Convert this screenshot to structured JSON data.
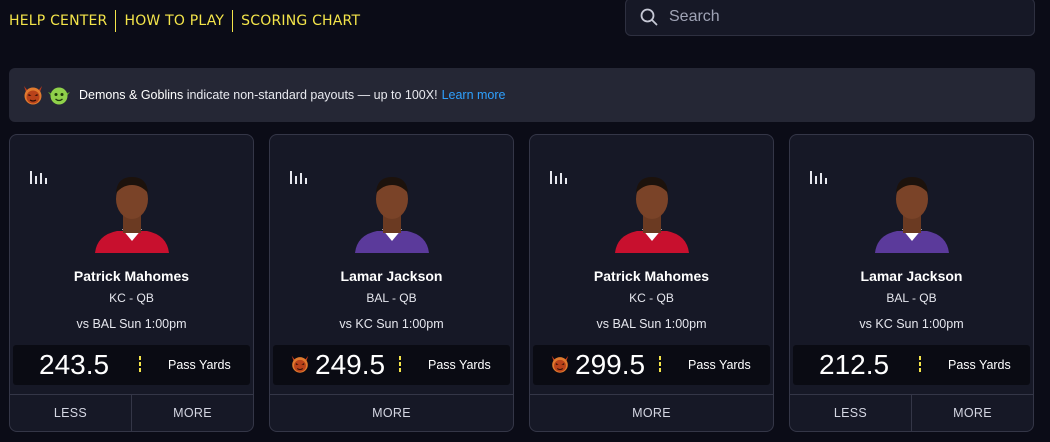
{
  "nav": {
    "help": "HELP CENTER",
    "howto": "HOW TO PLAY",
    "scoring": "SCORING CHART"
  },
  "search": {
    "placeholder": "Search"
  },
  "banner": {
    "title": "Demons & Goblins",
    "text": "indicate non-standard payouts — up to 100X!",
    "link": "Learn more"
  },
  "colors": {
    "accent": "#f4e54a",
    "link": "#2ea1ff",
    "demon": "#d7642c",
    "goblin": "#79c43a"
  },
  "cards": [
    {
      "name": "Patrick Mahomes",
      "team": "KC - QB",
      "game": "vs BAL Sun 1:00pm",
      "value": "243.5",
      "stat": "Pass Yards",
      "demon": false,
      "less": "LESS",
      "more": "MORE",
      "jersey": "#c8102e"
    },
    {
      "name": "Lamar Jackson",
      "team": "BAL - QB",
      "game": "vs KC Sun 1:00pm",
      "value": "249.5",
      "stat": "Pass Yards",
      "demon": true,
      "more": "MORE",
      "jersey": "#5b3a9b"
    },
    {
      "name": "Patrick Mahomes",
      "team": "KC - QB",
      "game": "vs BAL Sun 1:00pm",
      "value": "299.5",
      "stat": "Pass Yards",
      "demon": true,
      "more": "MORE",
      "jersey": "#c8102e"
    },
    {
      "name": "Lamar Jackson",
      "team": "BAL - QB",
      "game": "vs KC Sun 1:00pm",
      "value": "212.5",
      "stat": "Pass Yards",
      "demon": false,
      "less": "LESS",
      "more": "MORE",
      "jersey": "#5b3a9b"
    }
  ]
}
